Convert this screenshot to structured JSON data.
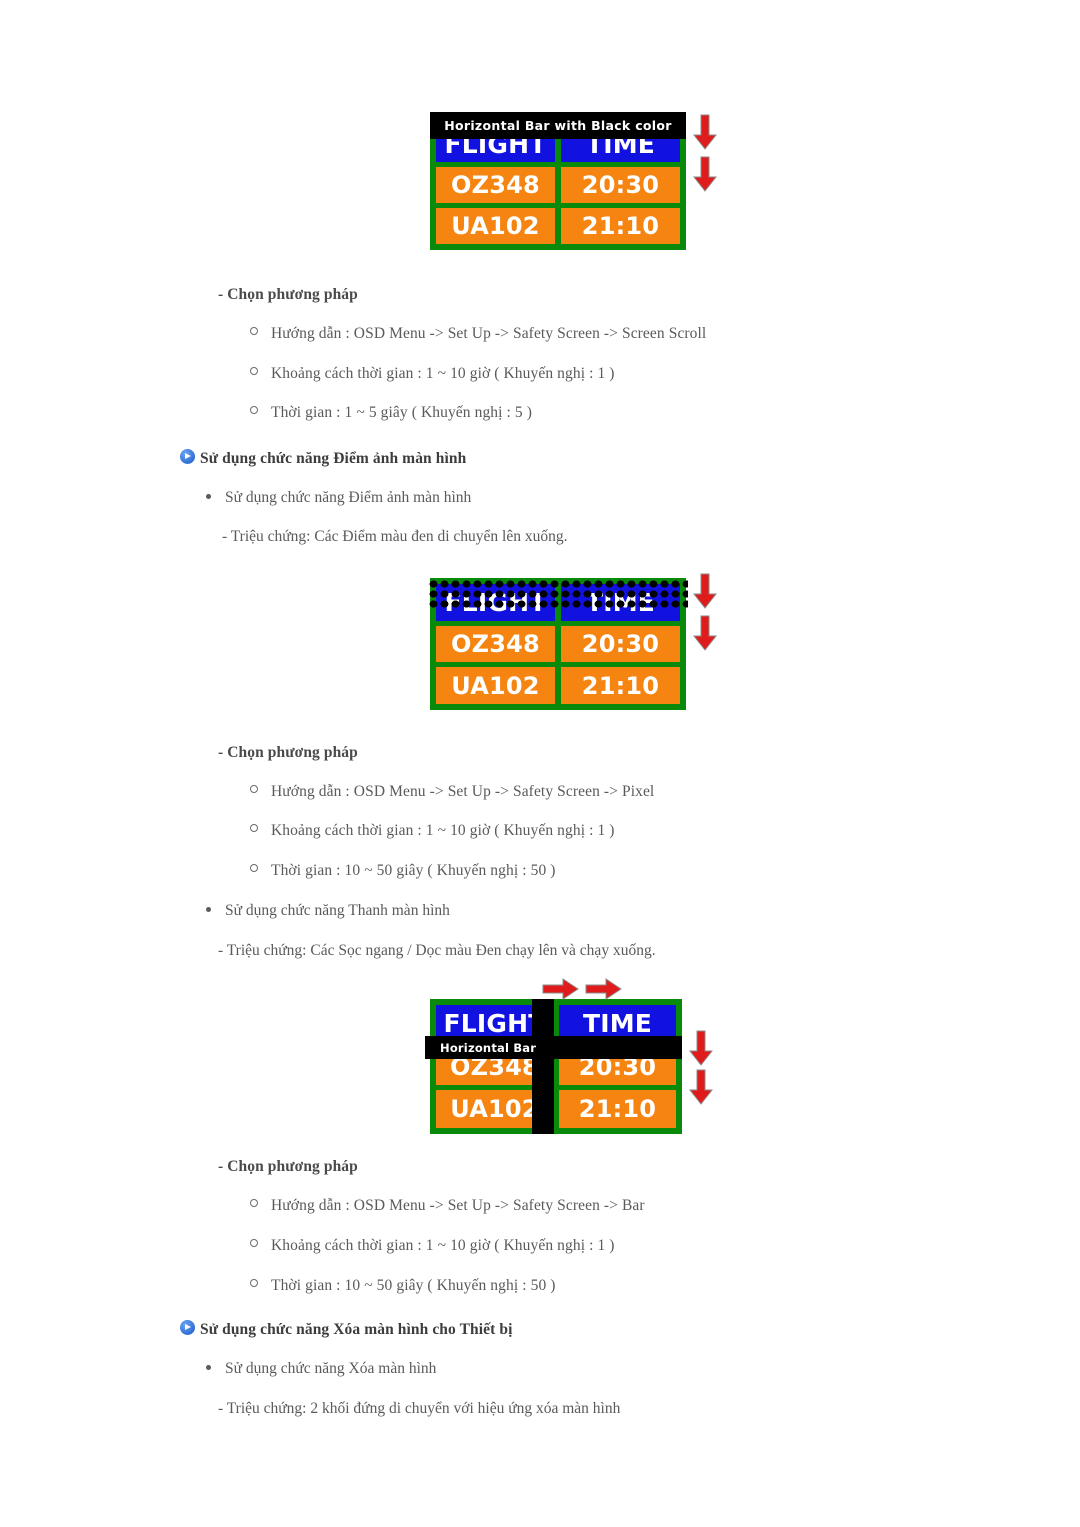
{
  "document": {
    "language": "vi",
    "text_color": "#5a5a5a",
    "heading_color": "#3d3d3d"
  },
  "board_common": {
    "header_flight": "FLIGHT",
    "header_time": "TIME",
    "row1_flight": "OZ348",
    "row1_time": "20:30",
    "row2_flight": "UA102",
    "row2_time": "21:10",
    "colors": {
      "frame_green": "#0a8a0a",
      "header_blue": "#1212e0",
      "data_orange": "#f58410",
      "bar_black": "#000000",
      "arrow_red": "#e01b1b",
      "text_white": "#ffffff"
    }
  },
  "figures": {
    "figure1": {
      "name": "screen-scroll-figure",
      "bar_label": "Horizontal Bar with Black color",
      "arrows": [
        "down",
        "down"
      ]
    },
    "figure2": {
      "name": "screen-pixel-figure",
      "arrows": [
        "down",
        "down"
      ]
    },
    "figure3": {
      "name": "screen-bar-figure",
      "bar_label": "Horizontal Bar",
      "arrows": [
        "right",
        "right",
        "down",
        "down"
      ]
    }
  },
  "blocks": {
    "scroll_method": {
      "title": "- Chọn phương pháp",
      "options": [
        "Hướng dẫn : OSD Menu -> Set Up -> Safety Screen -> Screen Scroll",
        "Khoảng cách thời gian : 1 ~ 10 giờ ( Khuyến nghị : 1 )",
        "Thời gian : 1 ~ 5 giây ( Khuyến nghị : 5 )"
      ]
    },
    "pixel_section": {
      "heading": "Sử dụng chức năng Điểm ảnh màn hình",
      "bullet": "Sử dụng chức năng Điểm ảnh màn hình",
      "symptom": "- Triệu chứng: Các Điểm màu đen di chuyển lên xuống."
    },
    "pixel_method": {
      "title": "- Chọn phương pháp",
      "options": [
        "Hướng dẫn : OSD Menu -> Set Up -> Safety Screen -> Pixel",
        "Khoảng cách thời gian : 1 ~ 10 giờ ( Khuyến nghị : 1 )",
        "Thời gian : 10 ~ 50 giây ( Khuyến nghị : 50 )"
      ]
    },
    "bar_section": {
      "bullet": "Sử dụng chức năng Thanh màn hình",
      "symptom": "- Triệu chứng: Các Sọc ngang / Dọc màu Đen chạy lên và chạy xuống."
    },
    "bar_method": {
      "title": "- Chọn phương pháp",
      "options": [
        "Hướng dẫn : OSD Menu -> Set Up -> Safety Screen -> Bar",
        "Khoảng cách thời gian : 1 ~ 10 giờ ( Khuyến nghị : 1 )",
        "Thời gian : 10 ~ 50 giây ( Khuyến nghị : 50 )"
      ]
    },
    "eraser_section": {
      "heading": "Sử dụng chức năng Xóa màn hình cho Thiết bị",
      "bullet": "Sử dụng chức năng Xóa màn hình",
      "symptom": "- Triệu chứng: 2 khối đứng di chuyển với hiệu ứng xóa màn hình"
    }
  }
}
